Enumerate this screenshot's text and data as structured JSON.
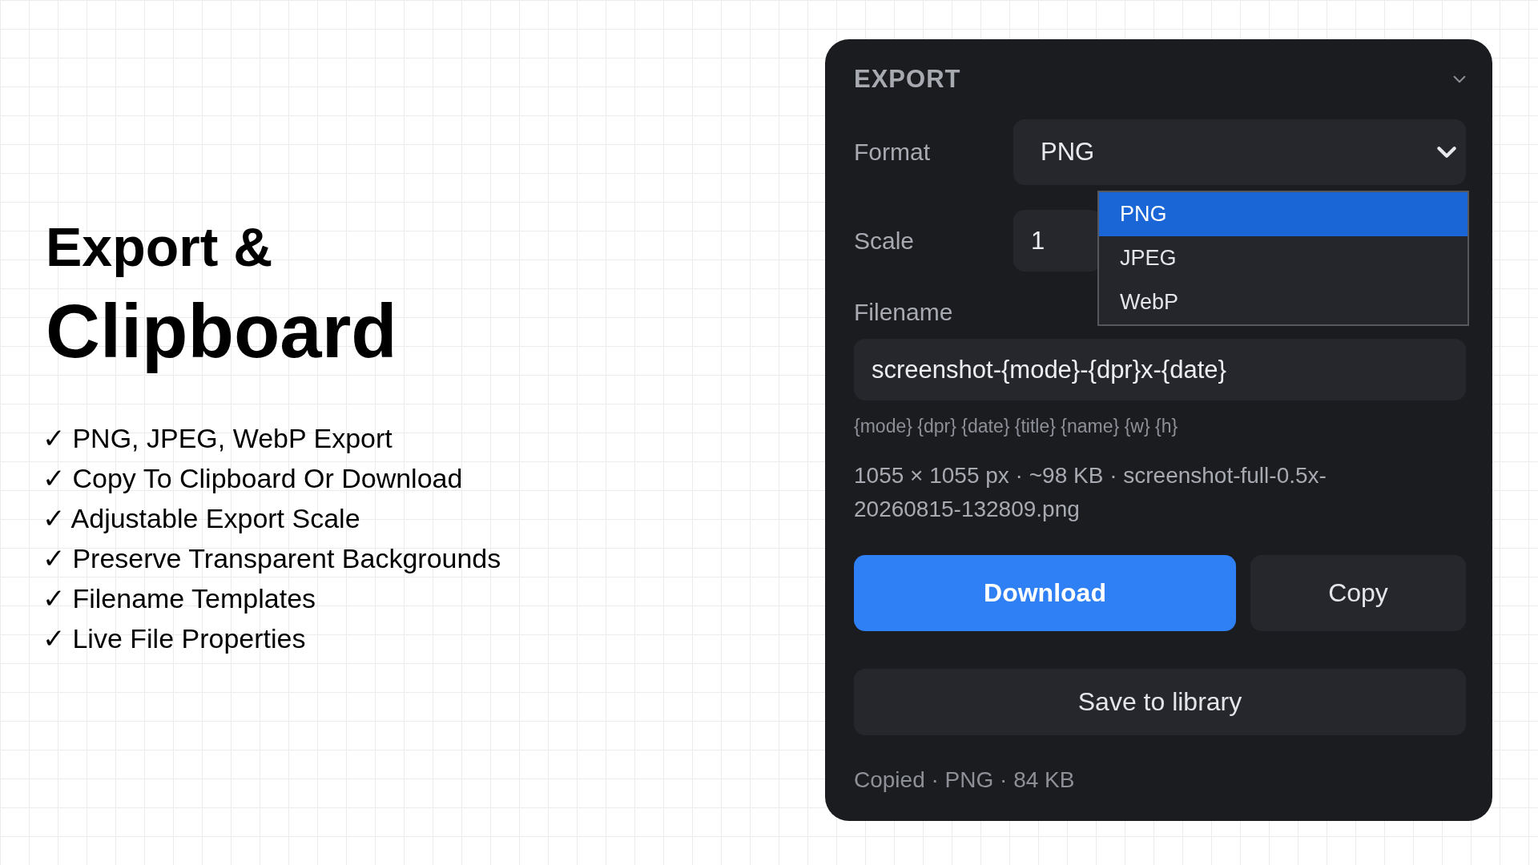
{
  "intro": {
    "title_line_1": "Export &",
    "title_line_2": "Clipboard",
    "features": [
      "✓ PNG, JPEG, WebP Export",
      "✓ Copy To Clipboard Or Download",
      "✓ Adjustable Export Scale",
      "✓ Preserve Transparent Backgrounds",
      "✓ Filename Templates",
      "✓ Live File Properties"
    ]
  },
  "panel": {
    "title": "EXPORT",
    "expanded": true,
    "format": {
      "label": "Format",
      "value": "PNG",
      "open": true,
      "options": [
        {
          "label": "PNG",
          "selected": true
        },
        {
          "label": "JPEG",
          "selected": false
        },
        {
          "label": "WebP",
          "selected": false
        }
      ]
    },
    "scale": {
      "label": "Scale",
      "value": "1"
    },
    "filename": {
      "label": "Filename",
      "value": "screenshot-{mode}-{dpr}x-{date}",
      "hint": "{mode} {dpr} {date} {title} {name} {w} {h}"
    },
    "info": "1055 × 1055 px · ~98 KB · screenshot-full-0.5x-20260815-132809.png",
    "buttons": [
      {
        "label": "Download",
        "kind": "primary"
      },
      {
        "label": "Copy",
        "kind": "secondary"
      },
      {
        "label": "Save to library",
        "kind": "wide"
      }
    ],
    "status": "Copied · PNG · 84 KB"
  }
}
